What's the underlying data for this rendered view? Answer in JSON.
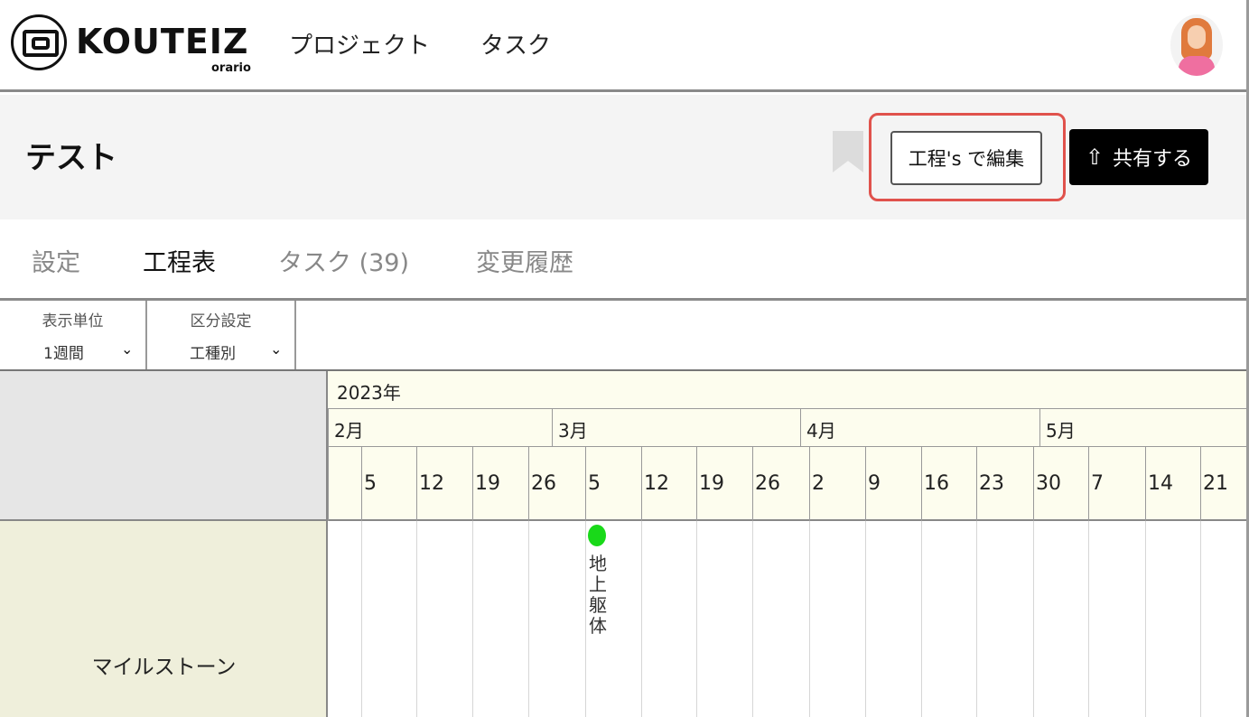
{
  "header": {
    "logo_text": "KOUTEIZ",
    "logo_sub": "orario",
    "nav": [
      "プロジェクト",
      "タスク"
    ]
  },
  "project": {
    "title": "テスト",
    "edit_button": "工程's で編集",
    "share_button": "共有する"
  },
  "tabs": [
    {
      "label": "設定",
      "active": false
    },
    {
      "label": "工程表",
      "active": true
    },
    {
      "label": "タスク (39)",
      "active": false
    },
    {
      "label": "変更履歴",
      "active": false
    }
  ],
  "filters": {
    "unit_label": "表示単位",
    "unit_value": "1週間",
    "category_label": "区分設定",
    "category_value": "工種別"
  },
  "gantt": {
    "year": "2023年",
    "months": [
      "2月",
      "3月",
      "4月",
      "5月"
    ],
    "weeks": [
      "",
      "5",
      "12",
      "19",
      "26",
      "5",
      "12",
      "19",
      "26",
      "2",
      "9",
      "16",
      "23",
      "30",
      "7",
      "14",
      "21"
    ],
    "row_label": "マイルストーン",
    "milestone": {
      "label": "地上躯体",
      "color": "#19d919"
    }
  },
  "colors": {
    "highlight": "#e0524c",
    "header_bg": "#fdfdee",
    "row_bg": "#efefdb"
  }
}
